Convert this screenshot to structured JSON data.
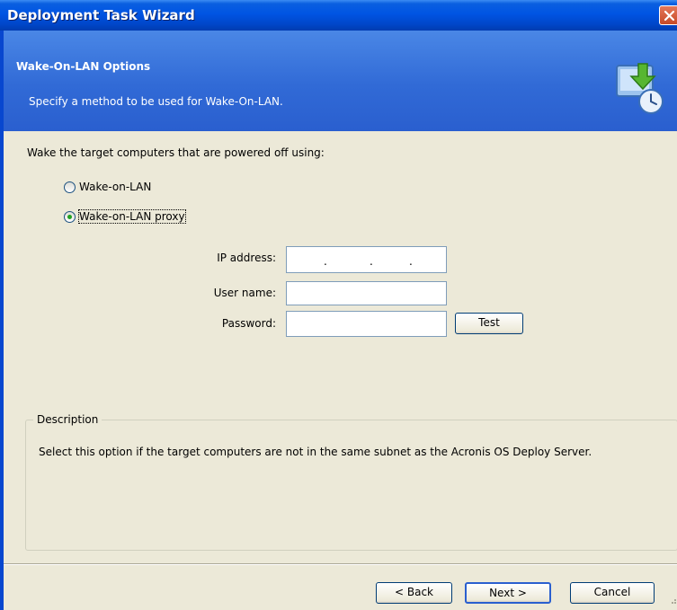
{
  "window": {
    "title": "Deployment Task Wizard"
  },
  "header": {
    "title": "Wake-On-LAN Options",
    "subtitle": "Specify a method to be used for Wake-On-LAN."
  },
  "prompt": "Wake the target computers that are powered off using:",
  "options": [
    {
      "label": "Wake-on-LAN",
      "selected": false
    },
    {
      "label": "Wake-on-LAN proxy",
      "selected": true
    }
  ],
  "form": {
    "ip_label": "IP address:",
    "ip_value": "",
    "user_label": "User name:",
    "user_value": "",
    "password_label": "Password:",
    "password_value": "",
    "test_button": "Test"
  },
  "description": {
    "legend": "Description",
    "text": "Select this option if the target computers are not in the same subnet as the Acronis OS Deploy Server."
  },
  "buttons": {
    "back": "< Back",
    "next": "Next >",
    "cancel": "Cancel"
  },
  "colors": {
    "titlebar": "#0054e3",
    "header": "#316ad6",
    "body": "#ece9d8",
    "radio_selected": "#21a121"
  },
  "icons": [
    "close-icon",
    "wizard-icon",
    "size-grip-icon"
  ]
}
